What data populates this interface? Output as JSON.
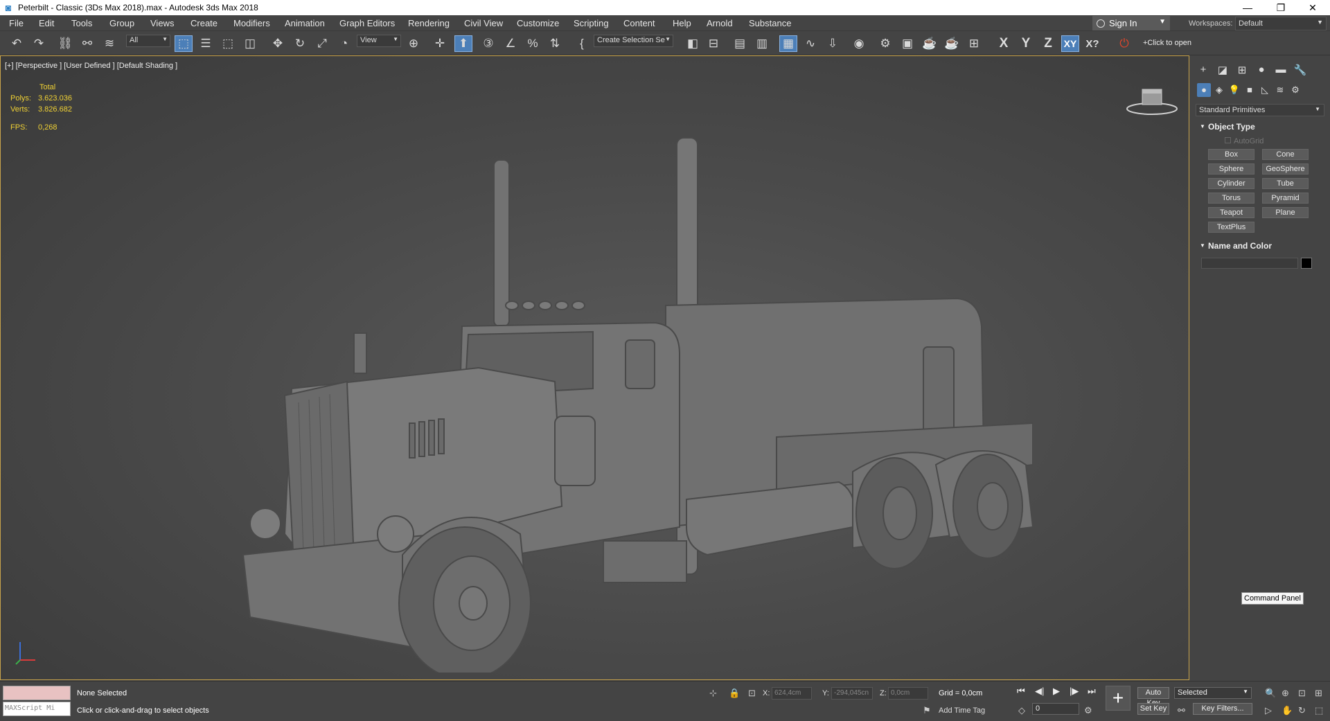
{
  "window": {
    "title": "Peterbilt - Classic (3Ds Max 2018).max - Autodesk 3ds Max 2018",
    "app_icon": "3ds-max-icon",
    "controls": [
      "minimize",
      "restore",
      "close"
    ]
  },
  "menubar": {
    "items": [
      "File",
      "Edit",
      "Tools",
      "Group",
      "Views",
      "Create",
      "Modifiers",
      "Animation",
      "Graph Editors",
      "Rendering",
      "Civil View",
      "Customize",
      "Scripting",
      "Content",
      "Help",
      "Arnold",
      "Substance"
    ],
    "sign_in": "Sign In",
    "workspace_label": "Workspaces:",
    "workspace_value": "Default"
  },
  "toolbar": {
    "selection_filter": "All",
    "reference_coord": "View",
    "named_selection": "Create Selection Se",
    "axis_x": "X",
    "axis_y": "Y",
    "axis_z": "Z",
    "axis_xy": "XY",
    "axis_help": "X?",
    "click_to_open": "+Click to open"
  },
  "viewport": {
    "label": "[+] [Perspective ] [User Defined ] [Default Shading ]",
    "stats": {
      "header": "Total",
      "polys_label": "Polys:",
      "polys_value": "3.623.036",
      "verts_label": "Verts:",
      "verts_value": "3.826.682",
      "fps_label": "FPS:",
      "fps_value": "0,268"
    },
    "border_color": "#c9a44c",
    "stats_color": "#f1d234"
  },
  "command_panel": {
    "category": "Standard Primitives",
    "object_type_title": "Object Type",
    "autogrid": "AutoGrid",
    "buttons": [
      "Box",
      "Cone",
      "Sphere",
      "GeoSphere",
      "Cylinder",
      "Tube",
      "Torus",
      "Pyramid",
      "Teapot",
      "Plane",
      "TextPlus"
    ],
    "name_color_title": "Name and Color",
    "swatch_color": "#000000",
    "tooltip": "Command Panel"
  },
  "status": {
    "maxscript_placeholder": "MAXScript Mi",
    "selection_status": "None Selected",
    "prompt": "Click or click-and-drag to select objects",
    "x_label": "X:",
    "x_value": "624,4cm",
    "y_label": "Y:",
    "y_value": "-294,045cn",
    "z_label": "Z:",
    "z_value": "0,0cm",
    "grid": "Grid = 0,0cm",
    "add_time_tag": "Add Time Tag",
    "auto_key": "Auto Key",
    "set_key": "Set Key",
    "key_mode": "Selected",
    "key_filters": "Key Filters...",
    "frame": "0"
  }
}
